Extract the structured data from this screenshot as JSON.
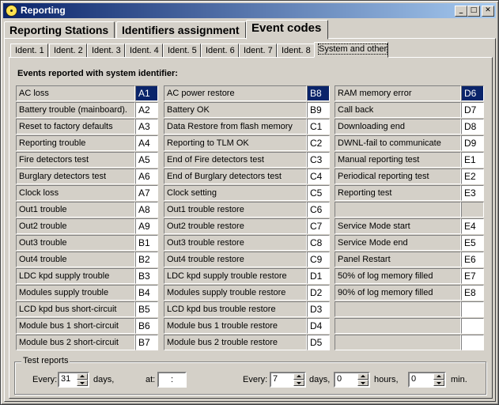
{
  "window": {
    "title": "Reporting",
    "minimize_label": "_",
    "maximize_label": "□",
    "close_label": "✕"
  },
  "main_tabs": [
    {
      "label": "Reporting Stations"
    },
    {
      "label": "Identifiers assignment"
    },
    {
      "label": "Event codes"
    }
  ],
  "sub_tabs": [
    {
      "label": "Ident. 1"
    },
    {
      "label": "Ident. 2"
    },
    {
      "label": "Ident. 3"
    },
    {
      "label": "Ident. 4"
    },
    {
      "label": "Ident. 5"
    },
    {
      "label": "Ident. 6"
    },
    {
      "label": "Ident. 7"
    },
    {
      "label": "Ident. 8"
    },
    {
      "label": "System and other"
    }
  ],
  "section_title": "Events reported with system identifier:",
  "columns": [
    {
      "rows": [
        {
          "label": "AC loss",
          "code": "A1",
          "selected": true
        },
        {
          "label": "Battery trouble (mainboard).",
          "code": "A2"
        },
        {
          "label": "Reset to factory defaults",
          "code": "A3"
        },
        {
          "label": "Reporting trouble",
          "code": "A4"
        },
        {
          "label": "Fire detectors test",
          "code": "A5"
        },
        {
          "label": "Burglary detectors test",
          "code": "A6"
        },
        {
          "label": "Clock loss",
          "code": "A7"
        },
        {
          "label": "Out1 trouble",
          "code": "A8"
        },
        {
          "label": "Out2 trouble",
          "code": "A9"
        },
        {
          "label": "Out3 trouble",
          "code": "B1"
        },
        {
          "label": "Out4 trouble",
          "code": "B2"
        },
        {
          "label": "LDC kpd supply trouble",
          "code": "B3"
        },
        {
          "label": "Modules supply trouble",
          "code": "B4"
        },
        {
          "label": "LCD kpd bus short-circuit",
          "code": "B5"
        },
        {
          "label": "Module bus 1 short-circuit",
          "code": "B6"
        },
        {
          "label": "Module bus 2 short-circuit",
          "code": "B7"
        }
      ]
    },
    {
      "rows": [
        {
          "label": "AC power restore",
          "code": "B8",
          "selected": true
        },
        {
          "label": "Battery OK",
          "code": "B9"
        },
        {
          "label": "Data Restore from flash memory",
          "code": "C1"
        },
        {
          "label": "Reporting to TLM OK",
          "code": "C2"
        },
        {
          "label": "End of Fire detectors test",
          "code": "C3"
        },
        {
          "label": "End of Burglary detectors test",
          "code": "C4"
        },
        {
          "label": "Clock setting",
          "code": "C5"
        },
        {
          "label": "Out1 trouble restore",
          "code": "C6"
        },
        {
          "label": "Out2 trouble restore",
          "code": "C7"
        },
        {
          "label": "Out3 trouble restore",
          "code": "C8"
        },
        {
          "label": "Out4 trouble restore",
          "code": "C9"
        },
        {
          "label": "LDC kpd supply trouble restore",
          "code": "D1"
        },
        {
          "label": "Modules supply trouble restore",
          "code": "D2"
        },
        {
          "label": "LCD kpd bus trouble restore",
          "code": "D3"
        },
        {
          "label": "Module bus 1 trouble restore",
          "code": "D4"
        },
        {
          "label": "Module bus 2 trouble restore",
          "code": "D5"
        }
      ]
    },
    {
      "rows": [
        {
          "label": "RAM memory error",
          "code": "D6",
          "selected": true
        },
        {
          "label": "Call back",
          "code": "D7"
        },
        {
          "label": "Downloading end",
          "code": "D8"
        },
        {
          "label": "DWNL-fail to communicate",
          "code": "D9"
        },
        {
          "label": "Manual reporting test",
          "code": "E1"
        },
        {
          "label": "Periodical reporting test",
          "code": "E2"
        },
        {
          "label": "Reporting test",
          "code": "E3"
        },
        {
          "label": "",
          "code": "",
          "gray": true
        },
        {
          "label": "Service Mode start",
          "code": "E4"
        },
        {
          "label": "Service Mode end",
          "code": "E5"
        },
        {
          "label": "Panel Restart",
          "code": "E6"
        },
        {
          "label": "50% of log memory filled",
          "code": "E7"
        },
        {
          "label": "90% of log memory filled",
          "code": "E8"
        },
        {
          "label": "",
          "code": ""
        },
        {
          "label": "",
          "code": ""
        },
        {
          "label": "",
          "code": ""
        }
      ]
    }
  ],
  "test_reports": {
    "group_label": "Test reports",
    "every_label_1": "Every:",
    "days_value_1": "31",
    "days_label_1": "days,",
    "at_label": "at:",
    "time_value": " : ",
    "every_label_2": "Every:",
    "days_value_2": "7",
    "days_label_2": "days,",
    "hours_value": "0",
    "hours_label": "hours,",
    "min_value": "0",
    "min_label": "min."
  }
}
